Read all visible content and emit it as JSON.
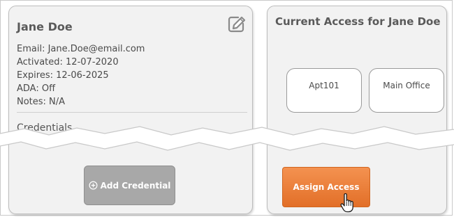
{
  "user": {
    "name": "Jane Doe",
    "email_line": "Email: Jane.Doe@email.com",
    "activated_line": "Activated: 12-07-2020",
    "expires_line": "Expires: 12-06-2025",
    "ada_line": "ADA: Off",
    "notes_line": "Notes: N/A",
    "edit_icon": "pencil-edit-icon"
  },
  "credentials": {
    "title": "Credentials",
    "add_button_label": "Add Credential",
    "add_icon": "plus-circle-icon"
  },
  "access": {
    "title": "Current Access for Jane Doe",
    "tiles": [
      "Apt101",
      "Main Office"
    ],
    "assign_button_label": "Assign Access"
  },
  "colors": {
    "accent_orange": "#EE7D39",
    "disabled_gray": "#A8A8A8",
    "card_background": "#F2F2F2"
  }
}
